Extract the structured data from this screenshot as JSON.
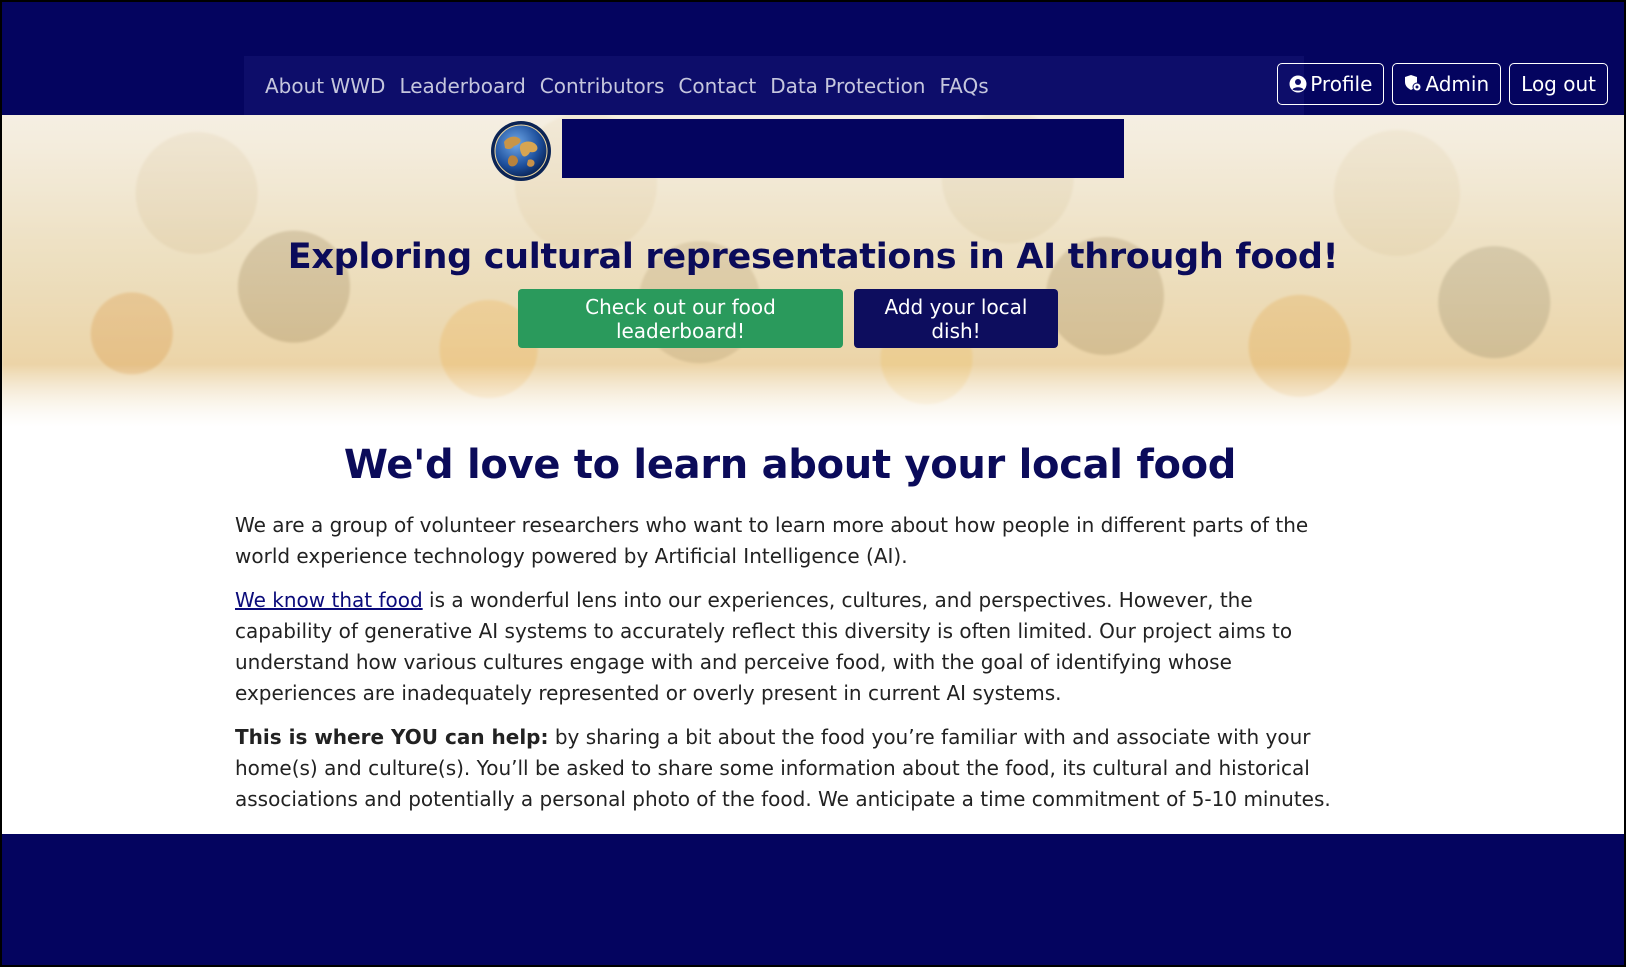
{
  "nav": {
    "links": [
      "About WWD",
      "Leaderboard",
      "Contributors",
      "Contact",
      "Data Protection",
      "FAQs"
    ],
    "profile_label": "Profile",
    "admin_label": "Admin",
    "logout_label": "Log out"
  },
  "hero": {
    "title": "Exploring cultural representations in AI through food!",
    "leaderboard_button": "Check out our food leaderboard!",
    "add_dish_button": "Add your local dish!"
  },
  "main": {
    "heading": "We'd love to learn about your local food",
    "para1": "We are a group of volunteer researchers who want to learn more about how people in different parts of the world experience technology powered by Artificial Intelligence (AI).",
    "para2_link": "We know that food",
    "para2_rest": " is a wonderful lens into our experiences, cultures, and perspectives. However, the capability of generative AI systems to accurately reflect this diversity is often limited. Our project aims to understand how various cultures engage with and perceive food, with the goal of identifying whose experiences are inadequately represented or overly present in current AI systems.",
    "para3_bold": "This is where YOU can help:",
    "para3_rest": " by sharing a bit about the food you’re familiar with and associate with your home(s) and culture(s). You’ll be asked to share some information about the food, its cultural and historical associations and potentially a personal photo of the food. We anticipate a time commitment of 5-10 minutes."
  },
  "colors": {
    "navy": "#04045f",
    "heading": "#0b0b5a",
    "green_button": "#2a9a5c"
  },
  "icons": {
    "profile": "user-circle-icon",
    "admin": "shield-icon",
    "logo": "globe-logo"
  }
}
